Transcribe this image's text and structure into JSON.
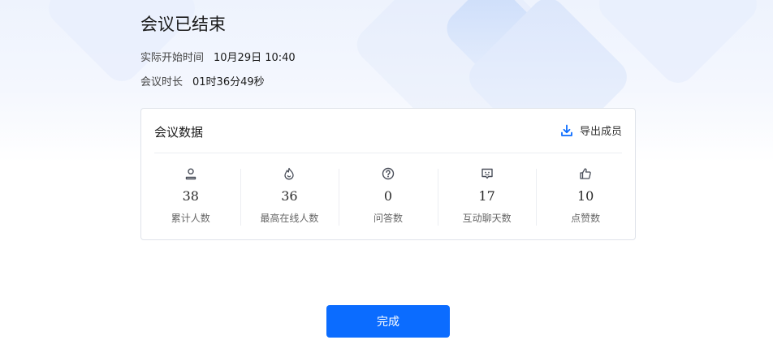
{
  "page": {
    "title": "会议已结束",
    "start_time_label": "实际开始时间",
    "start_time_value": "10月29日 10:40",
    "duration_label": "会议时长",
    "duration_value": "01时36分49秒"
  },
  "card": {
    "title": "会议数据",
    "export_label": "导出成员",
    "export_icon": "download-icon",
    "stats": [
      {
        "icon": "user-icon",
        "value": "38",
        "label": "累计人数"
      },
      {
        "icon": "flame-icon",
        "value": "36",
        "label": "最高在线人数"
      },
      {
        "icon": "question-icon",
        "value": "0",
        "label": "问答数"
      },
      {
        "icon": "chat-icon",
        "value": "17",
        "label": "互动聊天数"
      },
      {
        "icon": "thumbs-up-icon",
        "value": "10",
        "label": "点赞数"
      }
    ]
  },
  "footer": {
    "done_label": "完成"
  },
  "colors": {
    "primary": "#0b6cff",
    "icon": "#4a4f5a",
    "border": "#dfe3ea"
  }
}
